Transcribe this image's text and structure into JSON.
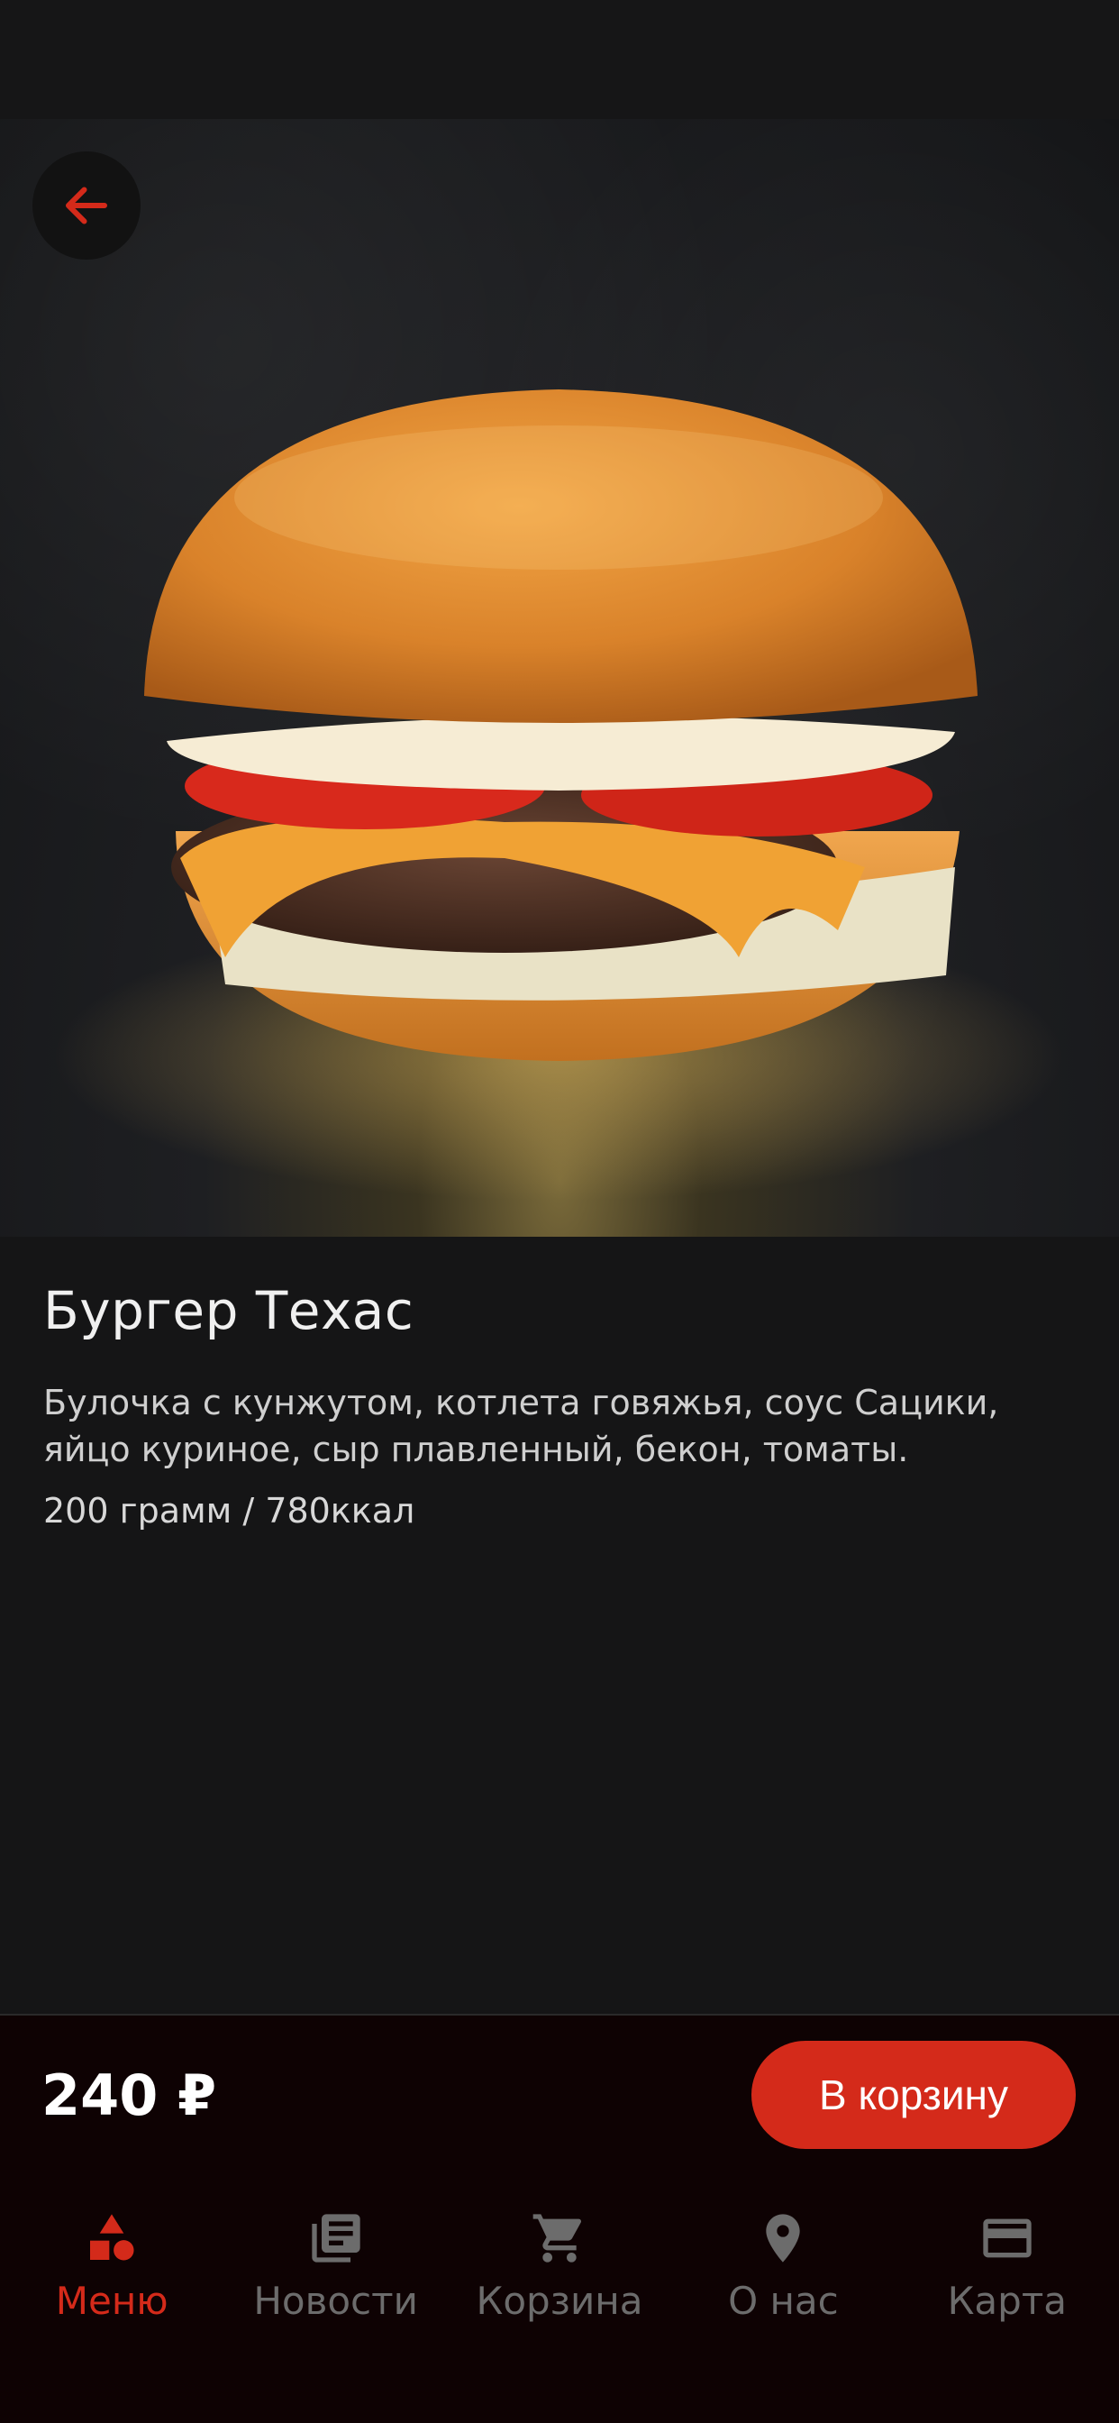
{
  "product": {
    "title": "Бургер Техас",
    "description": "Булочка с кунжутом, котлета говяжья, соус Сацики, яйцо куриное, сыр плавленный, бекон, томаты.",
    "weight_calories": "200 грамм / 780ккал",
    "price": "240 ₽",
    "add_to_cart_label": "В корзину"
  },
  "tabs": [
    {
      "label": "Меню",
      "icon": "menu-shapes-icon",
      "active": true
    },
    {
      "label": "Новости",
      "icon": "news-icon",
      "active": false
    },
    {
      "label": "Корзина",
      "icon": "cart-icon",
      "active": false
    },
    {
      "label": "О нас",
      "icon": "location-pin-icon",
      "active": false
    },
    {
      "label": "Карта",
      "icon": "card-icon",
      "active": false
    }
  ],
  "colors": {
    "accent": "#d42a1a",
    "background": "#151516",
    "bottom_bar": "#0e0203",
    "inactive": "#6c6c6c"
  }
}
